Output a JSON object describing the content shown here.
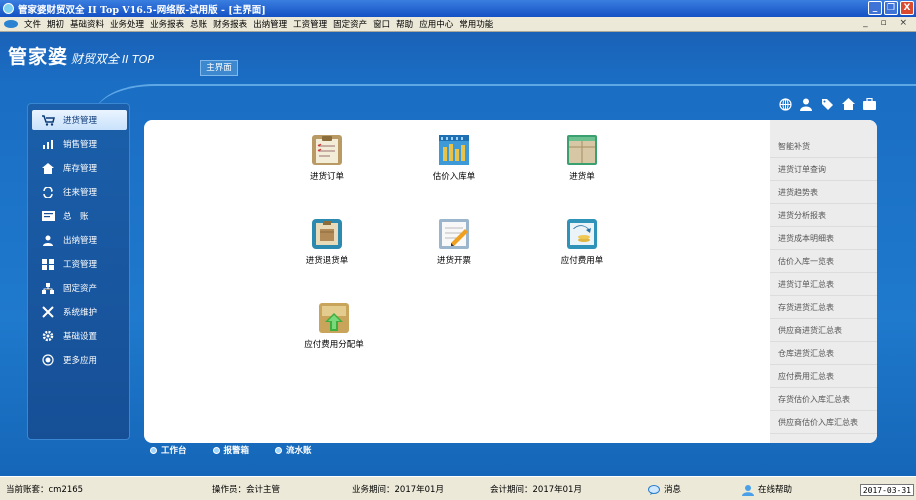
{
  "window": {
    "title": "管家婆财贸双全 II Top V16.5-网络版-试用版 - [主界面]",
    "minimize": "_",
    "maximize": "❐",
    "close": "X"
  },
  "menubar": {
    "items": [
      "文件",
      "期初",
      "基础资料",
      "业务处理",
      "业务报表",
      "总账",
      "财务报表",
      "出纳管理",
      "工资管理",
      "固定资产",
      "窗口",
      "帮助",
      "应用中心",
      "常用功能"
    ],
    "controls": "_ ▫ ×"
  },
  "header": {
    "logo_main": "管家婆",
    "logo_sub": "财贸双全",
    "logo_tail": "II TOP",
    "tab": "主界面"
  },
  "sidebar": {
    "items": [
      {
        "label": "进货管理",
        "icon": "cart-icon"
      },
      {
        "label": "销售管理",
        "icon": "chart-icon"
      },
      {
        "label": "库存管理",
        "icon": "house-icon"
      },
      {
        "label": "往来管理",
        "icon": "exchange-icon"
      },
      {
        "label": "总　账",
        "icon": "ledger-icon"
      },
      {
        "label": "出纳管理",
        "icon": "cashier-icon"
      },
      {
        "label": "工资管理",
        "icon": "grid-icon"
      },
      {
        "label": "固定资产",
        "icon": "org-icon"
      },
      {
        "label": "系统维护",
        "icon": "tools-icon"
      },
      {
        "label": "基础设置",
        "icon": "gear-icon"
      },
      {
        "label": "更多应用",
        "icon": "more-icon"
      }
    ]
  },
  "functions": {
    "items": [
      {
        "label": "进货订单",
        "icon": "clipboard-icon"
      },
      {
        "label": "估价入库单",
        "icon": "warehouse-icon"
      },
      {
        "label": "进货单",
        "icon": "box-icon"
      },
      {
        "label": "进货退货单",
        "icon": "return-box-icon"
      },
      {
        "label": "进货开票",
        "icon": "invoice-pen-icon"
      },
      {
        "label": "应付费用单",
        "icon": "payable-icon"
      },
      {
        "label": "应付费用分配单",
        "icon": "allocate-icon"
      }
    ]
  },
  "rightpanel": {
    "items": [
      "智能补货",
      "进货订单查询",
      "进货趋势表",
      "进货分析报表",
      "进货成本明细表",
      "估价入库一览表",
      "进货订单汇总表",
      "存货进货汇总表",
      "供应商进货汇总表",
      "仓库进货汇总表",
      "应付费用汇总表",
      "存货估价入库汇总表",
      "供应商估价入库汇总表"
    ]
  },
  "bottomtabs": {
    "items": [
      "工作台",
      "报警箱",
      "流水账"
    ]
  },
  "statusbar": {
    "account": "当前账套：cm2165",
    "operator": "操作员：会计主管",
    "business_period": "业务期间：2017年01月",
    "accounting_period": "会计期间：2017年01月",
    "message": "消息",
    "help": "在线帮助",
    "date": "2017-03-31"
  },
  "colors": {
    "background": "#1a6ec4",
    "content": "#ffffff",
    "sidebar_active": "#eaf4ff"
  }
}
